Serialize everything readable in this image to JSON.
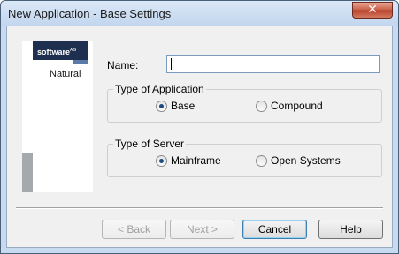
{
  "window": {
    "title": "New Application - Base Settings",
    "close_glyph": "✕"
  },
  "logo": {
    "brand": "software",
    "brand_mark": "AG",
    "product": "Natural"
  },
  "form": {
    "name_label": "Name:",
    "name_value": "",
    "application_group": {
      "label": "Type of Application",
      "options": [
        {
          "label": "Base",
          "checked": true
        },
        {
          "label": "Compound",
          "checked": false
        }
      ]
    },
    "server_group": {
      "label": "Type of Server",
      "options": [
        {
          "label": "Mainframe",
          "checked": true
        },
        {
          "label": "Open Systems",
          "checked": false
        }
      ]
    }
  },
  "buttons": {
    "back": "< Back",
    "next": "Next >",
    "cancel": "Cancel",
    "help": "Help"
  },
  "colors": {
    "frame": "#c8daf0",
    "close": "#c75c45",
    "logo_bg": "#1f2f4f",
    "radio_dot": "#1f4a80"
  }
}
